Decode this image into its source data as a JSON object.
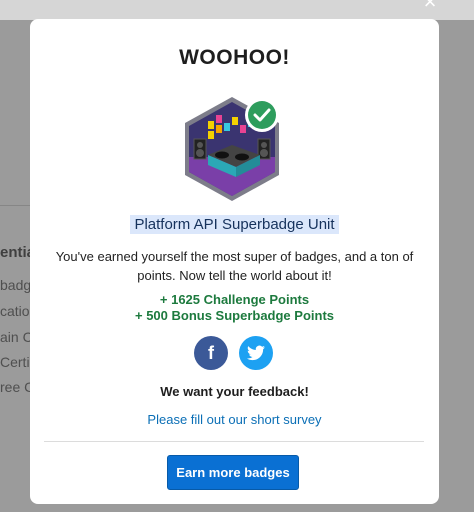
{
  "background_page": {
    "section_heading": "entia",
    "items": [
      "badg",
      "catio",
      "ain C",
      "Certi",
      "ree C"
    ]
  },
  "modal": {
    "close_symbol": "×",
    "title": "WOOHOO!",
    "badge_name": "Platform API Superbadge Unit",
    "description": "You've earned yourself the most super of badges, and a ton of points. Now tell the world about it!",
    "points": {
      "challenge": "+ 1625 Challenge Points",
      "bonus": "+ 500 Bonus Superbadge Points"
    },
    "share": {
      "facebook_glyph": "f",
      "twitter_glyph": ""
    },
    "feedback_heading": "We want your feedback!",
    "survey_link": "Please fill out our short survey",
    "cta_label": "Earn more badges"
  },
  "colors": {
    "cta": "#0a70d3",
    "points": "#1d7a3e",
    "link": "#0b6fb6",
    "facebook": "#3b5998",
    "twitter": "#1da1f2",
    "highlight": "#dbe7fb"
  }
}
